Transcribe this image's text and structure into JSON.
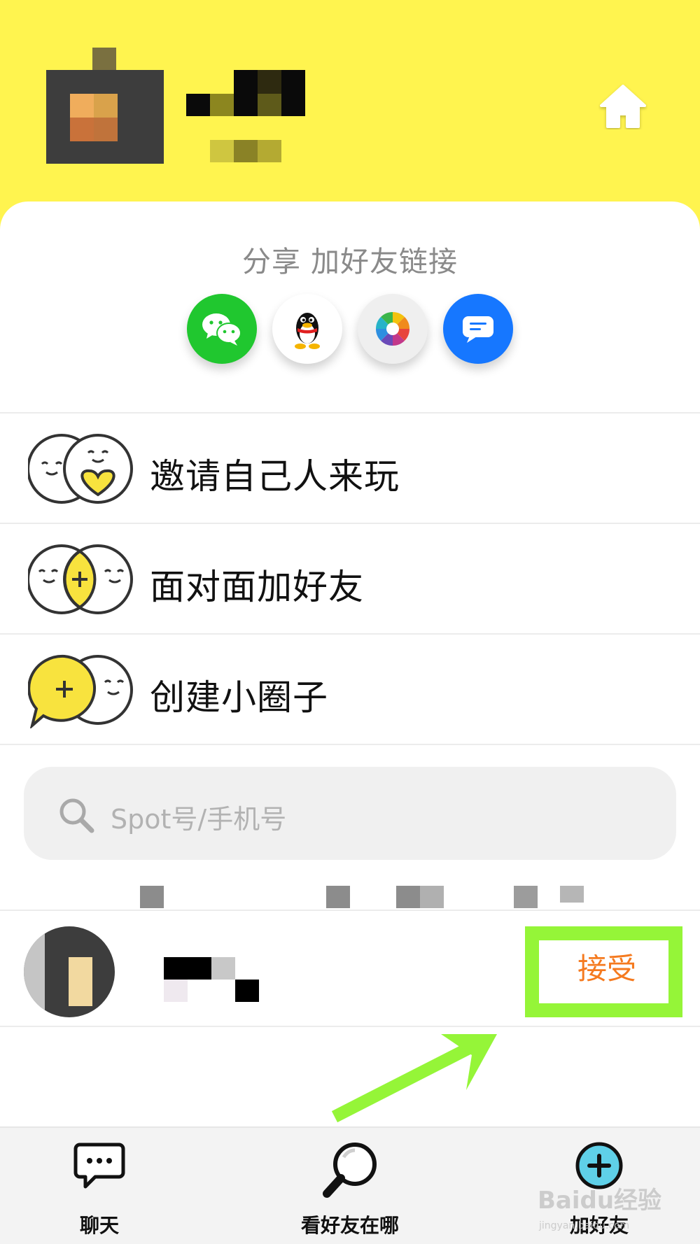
{
  "colors": {
    "accent": "#fff44f",
    "accept_text": "#f57a1f",
    "highlight": "#95f538",
    "wechat": "#20c72f",
    "message_blue": "#1677ff"
  },
  "header": {
    "home_icon": "home-icon"
  },
  "share": {
    "title": "分享 加好友链接",
    "targets": [
      {
        "name": "wechat",
        "icon": "wechat-icon"
      },
      {
        "name": "qq",
        "icon": "qq-penguin-icon"
      },
      {
        "name": "album",
        "icon": "camera-aperture-icon"
      },
      {
        "name": "message",
        "icon": "message-bubble-icon"
      }
    ]
  },
  "menu": {
    "items": [
      {
        "label": "邀请自己人来玩",
        "icon": "heart-faces-icon"
      },
      {
        "label": "面对面加好友",
        "icon": "overlap-faces-plus-icon"
      },
      {
        "label": "创建小圈子",
        "icon": "speech-bubble-plus-icon"
      }
    ]
  },
  "search": {
    "placeholder": "Spot号/手机号",
    "icon": "search-icon"
  },
  "request": {
    "accept_label": "接受"
  },
  "tabbar": {
    "tabs": [
      {
        "label": "聊天",
        "icon": "chat-bubble-icon"
      },
      {
        "label": "看好友在哪",
        "icon": "magnifier-icon"
      },
      {
        "label": "加好友",
        "icon": "add-friend-plus-icon",
        "active": true
      }
    ]
  },
  "watermark": {
    "text": "Baidu经验",
    "sub": "jingyan.baidu.com"
  }
}
